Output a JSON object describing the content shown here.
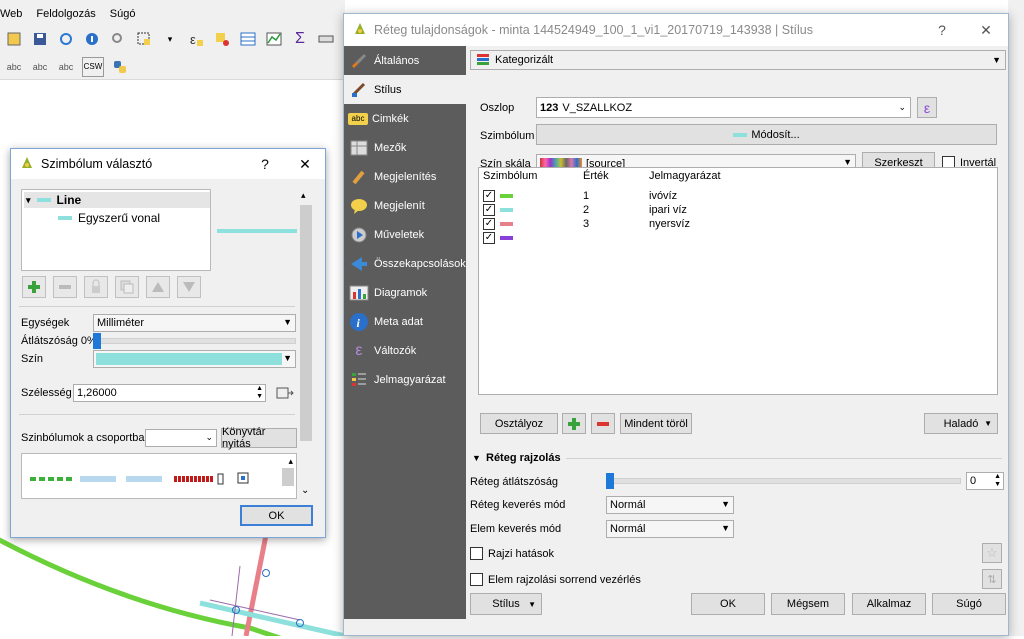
{
  "background_window": {
    "menu": [
      "Web",
      "Feldolgozás",
      "Súgó"
    ],
    "toolbar2_labels": [
      "abc",
      "abc",
      "abc",
      "CSW"
    ]
  },
  "symbol_dialog": {
    "title": "Szimbólum választó",
    "help_button": "?",
    "close_button": "✕",
    "tree": {
      "root": "Line",
      "child": "Egyszerű vonal"
    },
    "units_label": "Egységek",
    "units_value": "Milliméter",
    "opacity_label": "Átlátszóság 0%",
    "color_label": "Szín",
    "color_value": "#8ee0dc",
    "width_label": "Szélesség",
    "width_value": "1,26000",
    "group_label": "Szinbólumok a csoportban",
    "group_value": "",
    "library_button": "Könyvtár nyitás",
    "ok_button": "OK"
  },
  "layer_dialog": {
    "title": "Réteg tulajdonságok - minta 144524949_100_1_vi1_20170719_143938 | Stílus",
    "help_button": "?",
    "close_button": "✕",
    "sidebar": [
      {
        "label": "Általános",
        "icon": "wrench-icon"
      },
      {
        "label": "Stílus",
        "icon": "paintbrush-icon"
      },
      {
        "label": "Cimkék",
        "icon": "abc-label-icon"
      },
      {
        "label": "Mezők",
        "icon": "table-icon"
      },
      {
        "label": "Megjelenítés",
        "icon": "brush-icon"
      },
      {
        "label": "Megjelenít",
        "icon": "speech-bubble-icon"
      },
      {
        "label": "Műveletek",
        "icon": "gear-play-icon"
      },
      {
        "label": "Összekapcsolások",
        "icon": "join-icon"
      },
      {
        "label": "Diagramok",
        "icon": "diagram-icon"
      },
      {
        "label": "Meta adat",
        "icon": "info-icon"
      },
      {
        "label": "Változók",
        "icon": "epsilon-icon"
      },
      {
        "label": "Jelmagyarázat",
        "icon": "legend-icon"
      }
    ],
    "renderer": "Kategorizált",
    "column_label": "Oszlop",
    "column_prefix": "123",
    "column_value": "V_SZALLKOZ",
    "symbol_label": "Szimbólum",
    "symbol_button": "Módosít...",
    "ramp_label": "Szín skála",
    "ramp_value": "[source]",
    "edit_button": "Szerkeszt",
    "inverted_label": "Invertál",
    "list_headers": [
      "Szimbólum",
      "Érték",
      "Jelmagyarázat"
    ],
    "categories": [
      {
        "value": "1",
        "legend": "ivóvíz",
        "color": "#6ad13a",
        "checked": "✓"
      },
      {
        "value": "2",
        "legend": "ipari víz",
        "color": "#8ee0dc",
        "checked": "✓"
      },
      {
        "value": "3",
        "legend": "nyersvíz",
        "color": "#e8808a",
        "checked": "✓"
      },
      {
        "value": "",
        "legend": "",
        "color": "#8a3fd8",
        "checked": "✓"
      }
    ],
    "classify_button": "Osztályoz",
    "delete_all_button": "Mindent töröl",
    "advanced_button": "Haladó",
    "rendering_section": "Réteg rajzolás",
    "layer_opacity_label": "Réteg átlátszóság",
    "layer_opacity_value": "0",
    "layer_blend_label": "Réteg keverés mód",
    "layer_blend_value": "Normál",
    "feature_blend_label": "Elem keverés mód",
    "feature_blend_value": "Normál",
    "effects_label": "Rajzi hatások",
    "order_label": "Elem rajzolási sorrend vezérlés",
    "style_button": "Stílus",
    "ok_button": "OK",
    "cancel_button": "Mégsem",
    "apply_button": "Alkalmaz",
    "help_footer_button": "Súgó"
  }
}
